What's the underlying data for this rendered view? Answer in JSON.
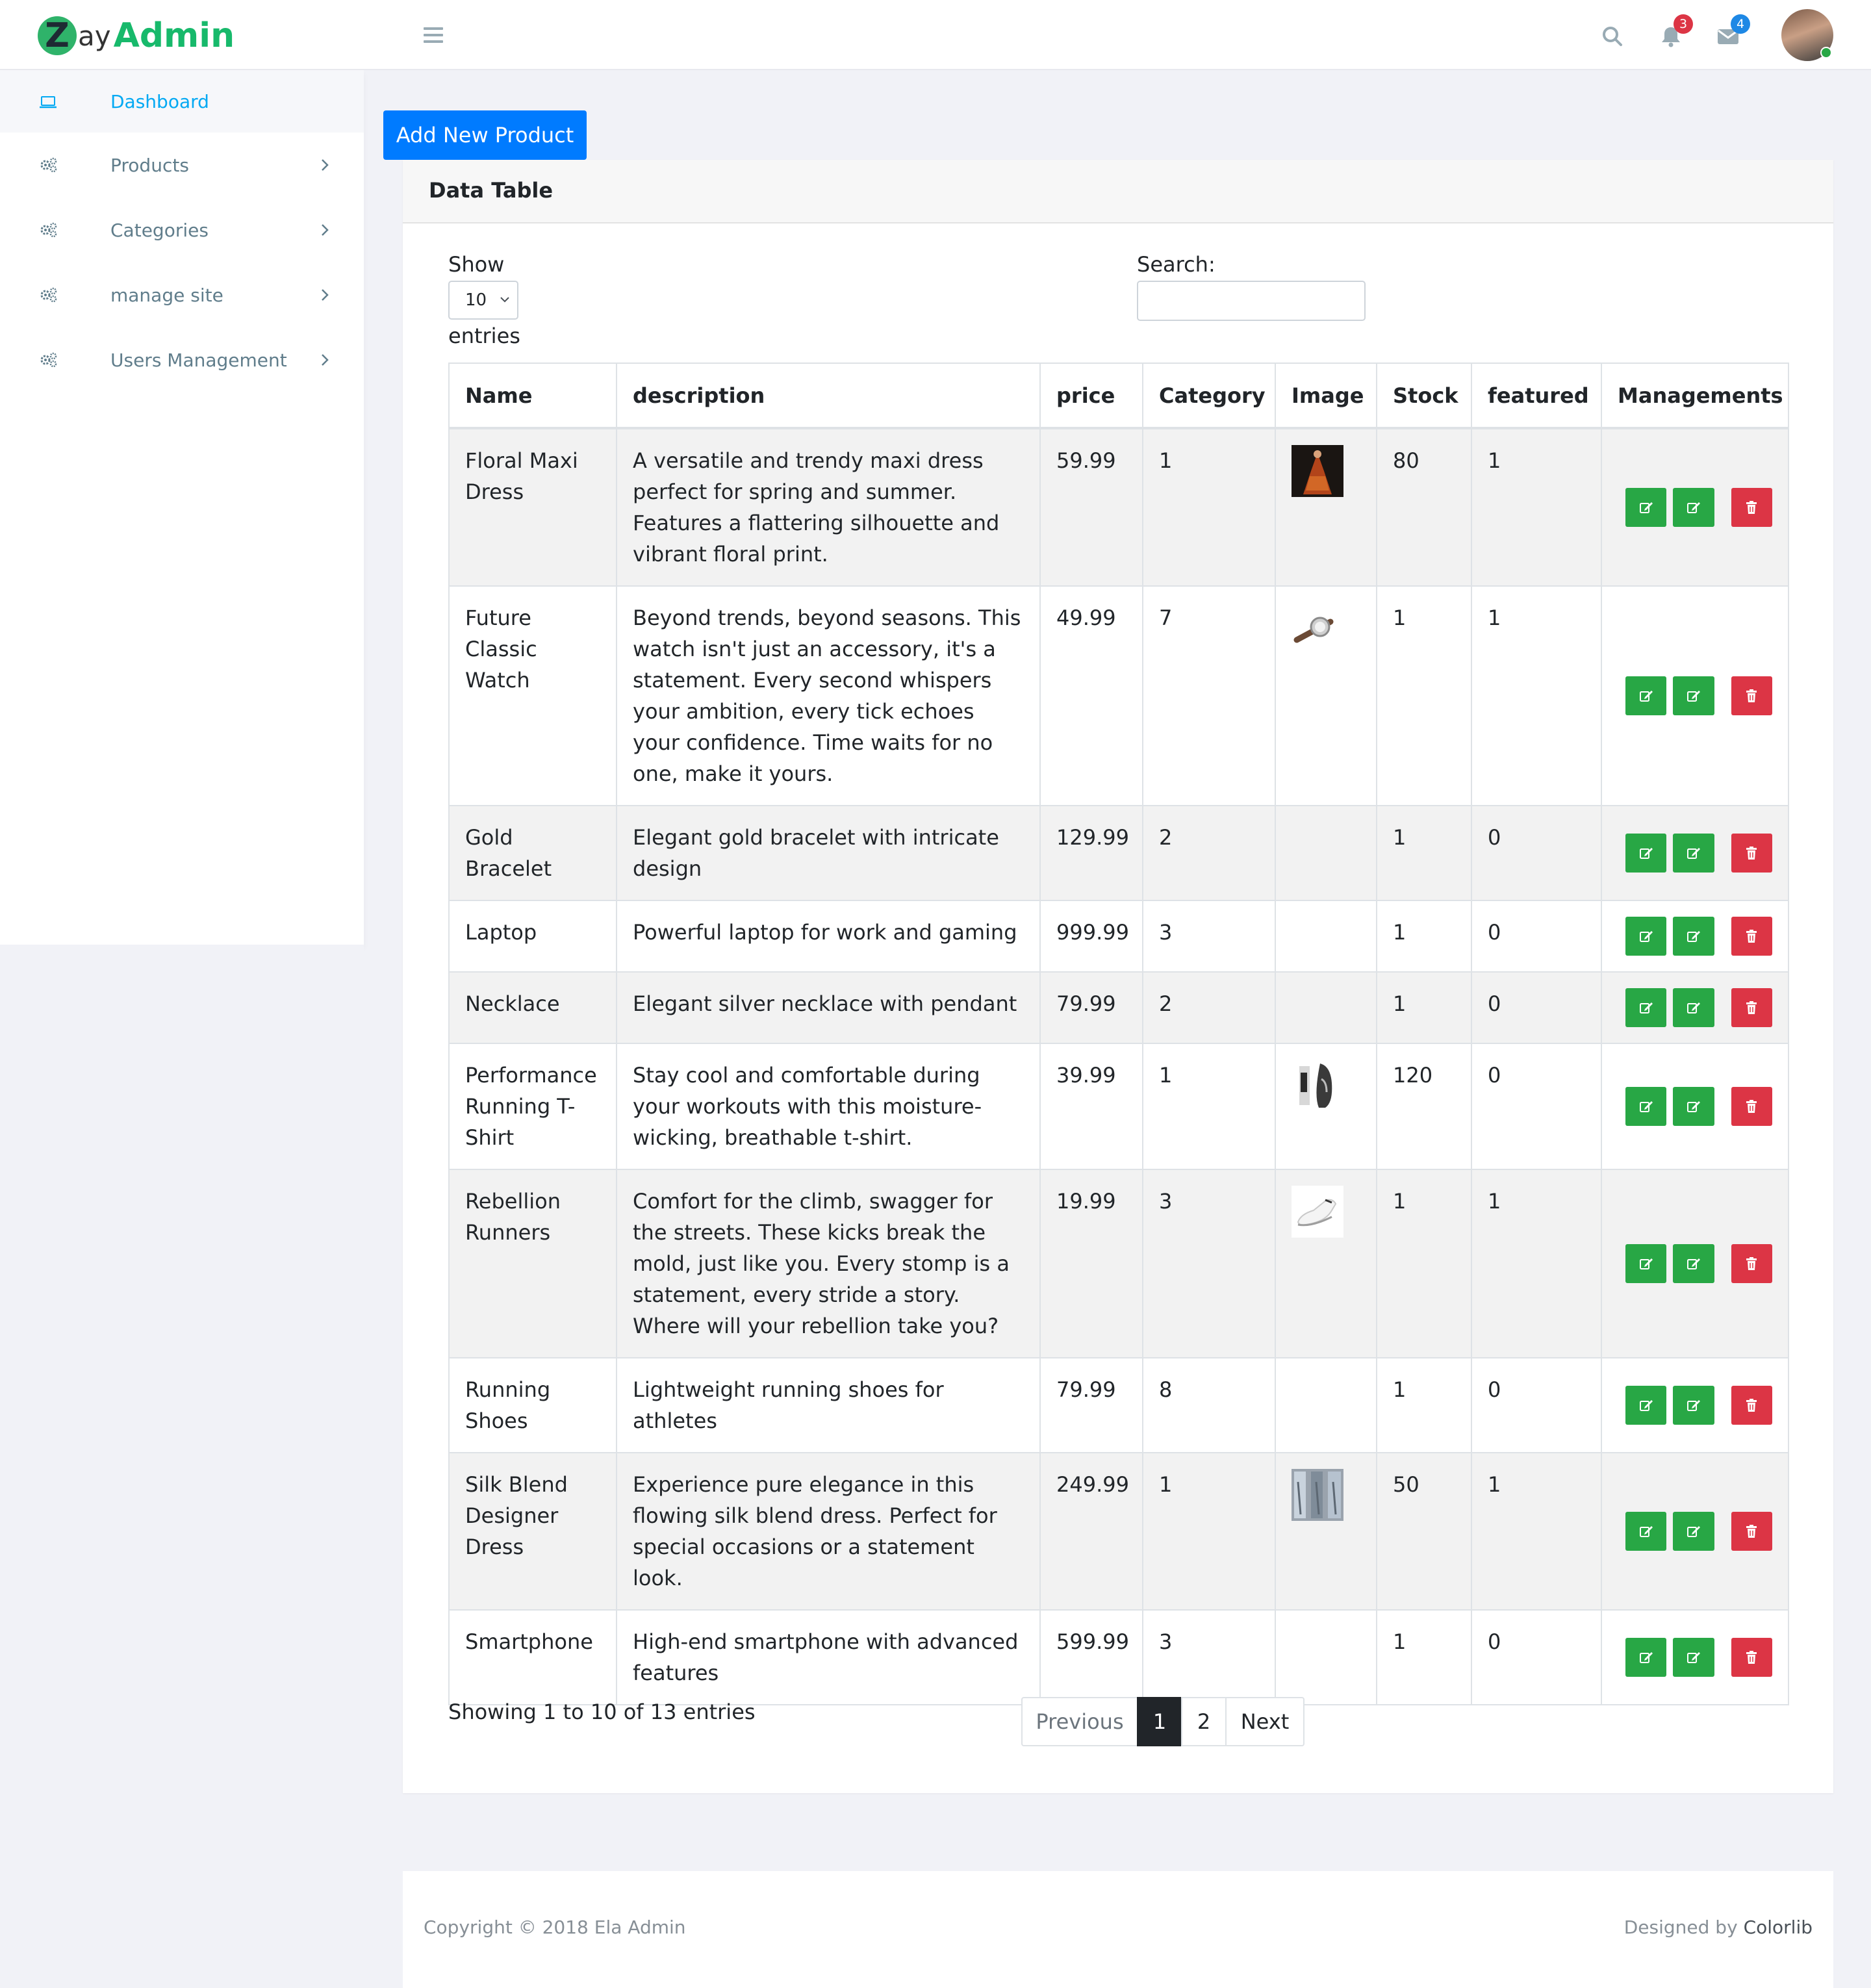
{
  "header": {
    "logo_z": "Z",
    "logo_ay": "ay",
    "logo_admin": "Admin",
    "notifications_count": "3",
    "messages_count": "4"
  },
  "sidebar": {
    "items": [
      {
        "label": "Dashboard",
        "icon": "laptop-icon",
        "active": true
      },
      {
        "label": "Products",
        "icon": "gears-icon"
      },
      {
        "label": "Categories",
        "icon": "gears-icon"
      },
      {
        "label": "manage site",
        "icon": "gears-icon"
      },
      {
        "label": "Users Management",
        "icon": "gears-icon"
      }
    ]
  },
  "main": {
    "add_button": "Add New Product",
    "card_title": "Data Table",
    "show_label": "Show",
    "page_length": "10",
    "entries_label": "entries",
    "search_label": "Search:",
    "search_value": "",
    "columns": [
      "Name",
      "description",
      "price",
      "Category",
      "Image",
      "Stock",
      "featured",
      "Managements"
    ],
    "rows": [
      {
        "name": "Floral Maxi Dress",
        "description": "A versatile and trendy maxi dress perfect for spring and summer. Features a flattering silhouette and vibrant floral print.",
        "price": "59.99",
        "category": "1",
        "image": "dress",
        "stock": "80",
        "featured": "1"
      },
      {
        "name": "Future Classic Watch",
        "description": "Beyond trends, beyond seasons. This watch isn't just an accessory, it's a statement. Every second whispers your ambition, every tick echoes your confidence. Time waits for no one, make it yours.",
        "price": "49.99",
        "category": "7",
        "image": "watch",
        "stock": "1",
        "featured": "1"
      },
      {
        "name": "Gold Bracelet",
        "description": "Elegant gold bracelet with intricate design",
        "price": "129.99",
        "category": "2",
        "image": "",
        "stock": "1",
        "featured": "0"
      },
      {
        "name": "Laptop",
        "description": "Powerful laptop for work and gaming",
        "price": "999.99",
        "category": "3",
        "image": "",
        "stock": "1",
        "featured": "0"
      },
      {
        "name": "Necklace",
        "description": "Elegant silver necklace with pendant",
        "price": "79.99",
        "category": "2",
        "image": "",
        "stock": "1",
        "featured": "0"
      },
      {
        "name": "Performance Running T-Shirt",
        "description": "Stay cool and comfortable during your workouts with this moisture-wicking, breathable t-shirt.",
        "price": "39.99",
        "category": "1",
        "image": "tshirt",
        "stock": "120",
        "featured": "0"
      },
      {
        "name": "Rebellion Runners",
        "description": "Comfort for the climb, swagger for the streets. These kicks break the mold, just like you. Every stomp is a statement, every stride a story. Where will your rebellion take you?",
        "price": "19.99",
        "category": "3",
        "image": "sneaker",
        "stock": "1",
        "featured": "1"
      },
      {
        "name": "Running Shoes",
        "description": "Lightweight running shoes for athletes",
        "price": "79.99",
        "category": "8",
        "image": "",
        "stock": "1",
        "featured": "0"
      },
      {
        "name": "Silk Blend Designer Dress",
        "description": "Experience pure elegance in this flowing silk blend dress. Perfect for special occasions or a statement look.",
        "price": "249.99",
        "category": "1",
        "image": "silk",
        "stock": "50",
        "featured": "1"
      },
      {
        "name": "Smartphone",
        "description": "High-end smartphone with advanced features",
        "price": "599.99",
        "category": "3",
        "image": "",
        "stock": "1",
        "featured": "0"
      }
    ],
    "info": "Showing 1 to 10 of 13 entries",
    "pagination": {
      "previous": "Previous",
      "pages": [
        "1",
        "2"
      ],
      "current": "1",
      "next": "Next"
    }
  },
  "footer": {
    "copyright": "Copyright © 2018 Ela Admin",
    "designed_prefix": "Designed by ",
    "designed_by": "Colorlib"
  },
  "colors": {
    "primary": "#007bff",
    "success": "#28a745",
    "danger": "#dc3545",
    "brand_green": "#17b96b",
    "sidebar_active": "#03a9f3"
  }
}
